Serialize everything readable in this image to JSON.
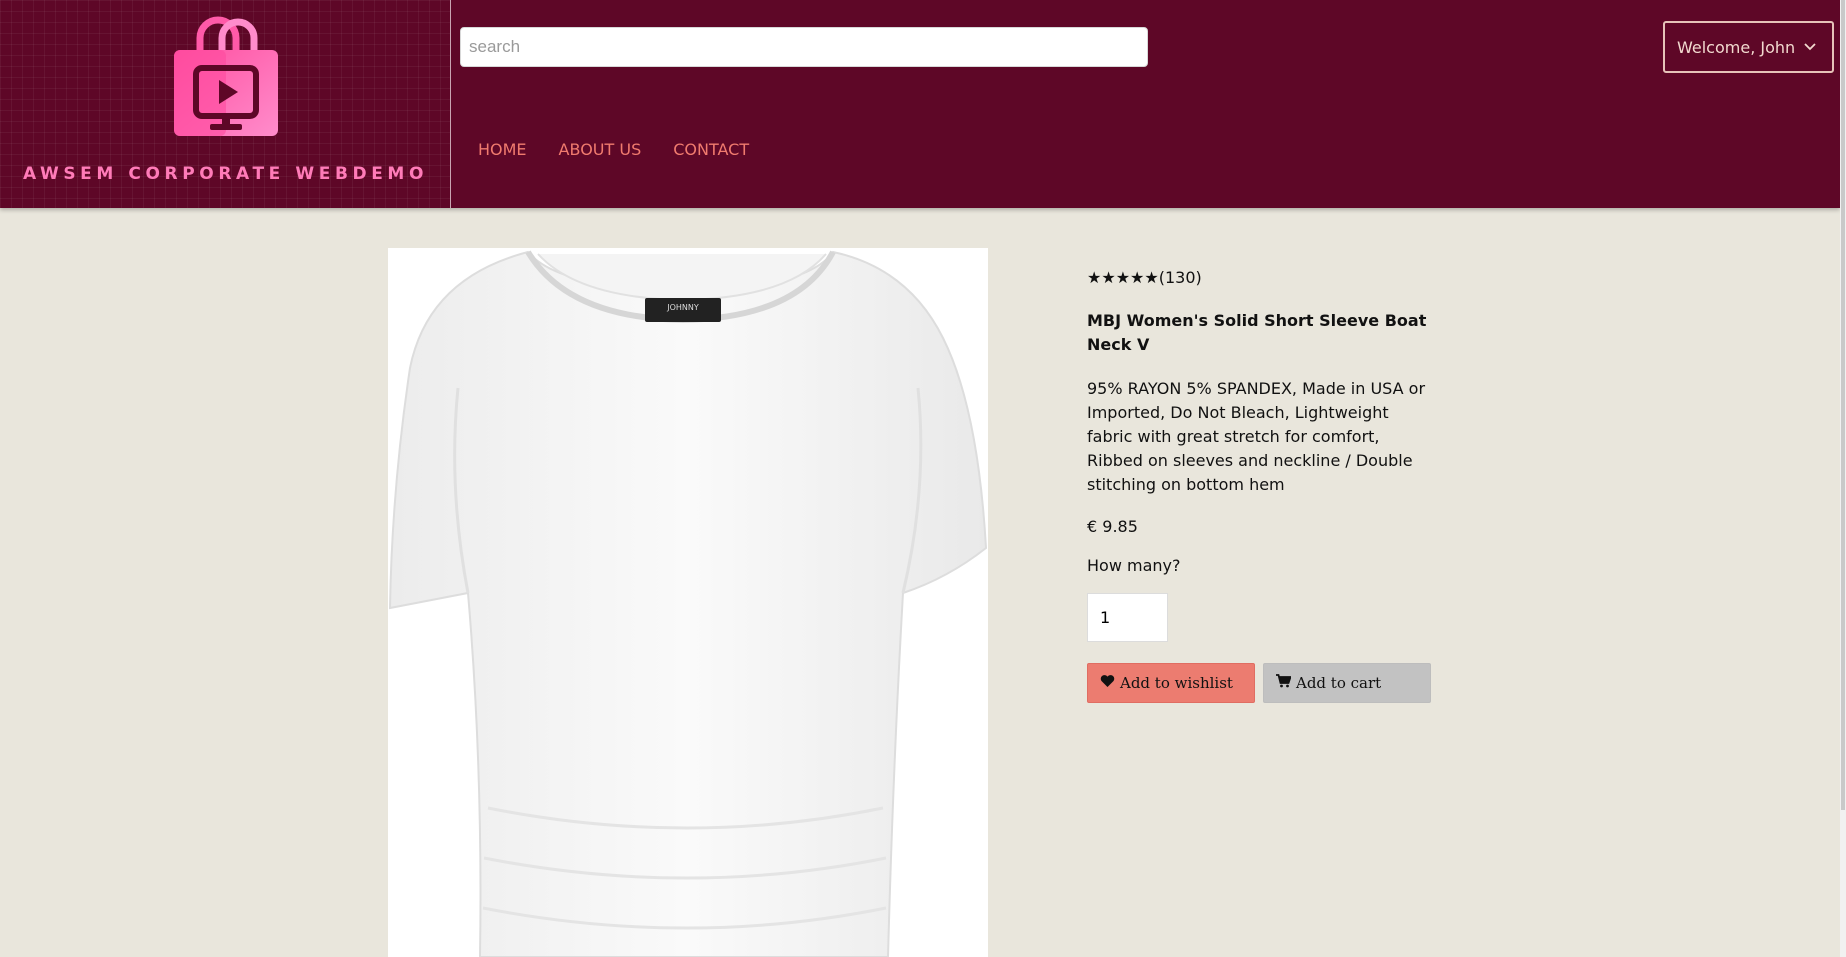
{
  "brand": {
    "name": "AWSEM CORPORATE WEBDEMO",
    "accent": "#ff7bb8",
    "header_bg": "#5e0727"
  },
  "search": {
    "placeholder": "search"
  },
  "nav": [
    {
      "label": "HOME"
    },
    {
      "label": "ABOUT US"
    },
    {
      "label": "CONTACT"
    }
  ],
  "user": {
    "welcome": "Welcome, John"
  },
  "product": {
    "stars": "★★★★★",
    "review_count": "(130)",
    "title": "MBJ Women's Solid Short Sleeve Boat Neck V",
    "description": "95% RAYON 5% SPANDEX, Made in USA or Imported, Do Not Bleach, Lightweight fabric with great stretch for comfort, Ribbed on sleeves and neckline / Double stitching on bottom hem",
    "price": "€ 9.85",
    "quantity_label": "How many?",
    "quantity_value": "1",
    "image_label": "JOHNNY"
  },
  "actions": {
    "wishlist": "Add to wishlist",
    "cart": "Add to cart"
  }
}
